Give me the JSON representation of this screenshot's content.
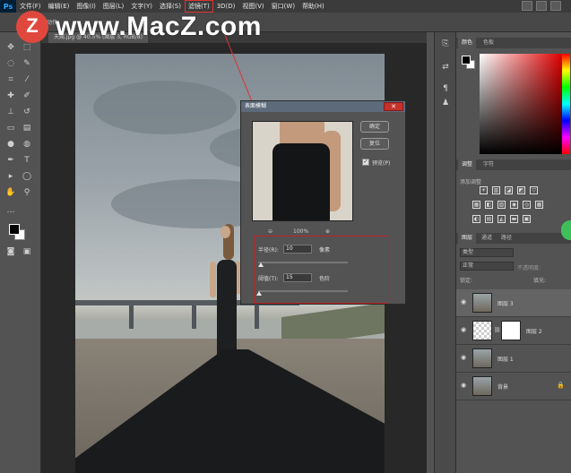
{
  "watermark": {
    "badge": "Z",
    "text": "www.MacZ.com"
  },
  "app": {
    "logo": "Ps"
  },
  "menu": {
    "items": [
      "文件(F)",
      "编辑(E)",
      "图像(I)",
      "图层(L)",
      "文字(Y)",
      "选择(S)",
      "滤镜(T)",
      "3D(D)",
      "视图(V)",
      "窗口(W)",
      "帮助(H)"
    ]
  },
  "options": {
    "partial_label": "动作"
  },
  "document": {
    "tab": "天赐.jpg @ 40.5% (图层 3, RGB/8)"
  },
  "dialog": {
    "title": "表面模糊",
    "close": "✕",
    "ok": "确定",
    "reset": "复位",
    "preview_label": "预览(P)",
    "preview_checked": "✓",
    "zoom": "100%",
    "zoom_out": "⊖",
    "zoom_in": "⊕",
    "radius_label": "半径(R):",
    "radius_value": "10",
    "radius_unit": "像素",
    "threshold_label": "阈值(T):",
    "threshold_value": "15",
    "threshold_unit": "色阶"
  },
  "panels": {
    "color_tabs": [
      "颜色",
      "色板"
    ],
    "adjust_tabs": [
      "调整",
      "字符"
    ],
    "adjust_title": "添加调整",
    "layer_tabs": [
      "图层",
      "通道",
      "路径"
    ],
    "filter_kind": "类型",
    "blend_mode": "正常",
    "opacity_label": "不透明度:",
    "lock_label": "锁定:",
    "fill_label": "填充:"
  },
  "layers": [
    {
      "name": "图层 3",
      "selected": true
    },
    {
      "name": "图层 2",
      "selected": false
    },
    {
      "name": "图层 1",
      "selected": false
    },
    {
      "name": "背景",
      "selected": false
    }
  ],
  "colors": {
    "accent_red": "#d33333",
    "close_red": "#c7302b",
    "watermark_red": "#e0483e"
  }
}
